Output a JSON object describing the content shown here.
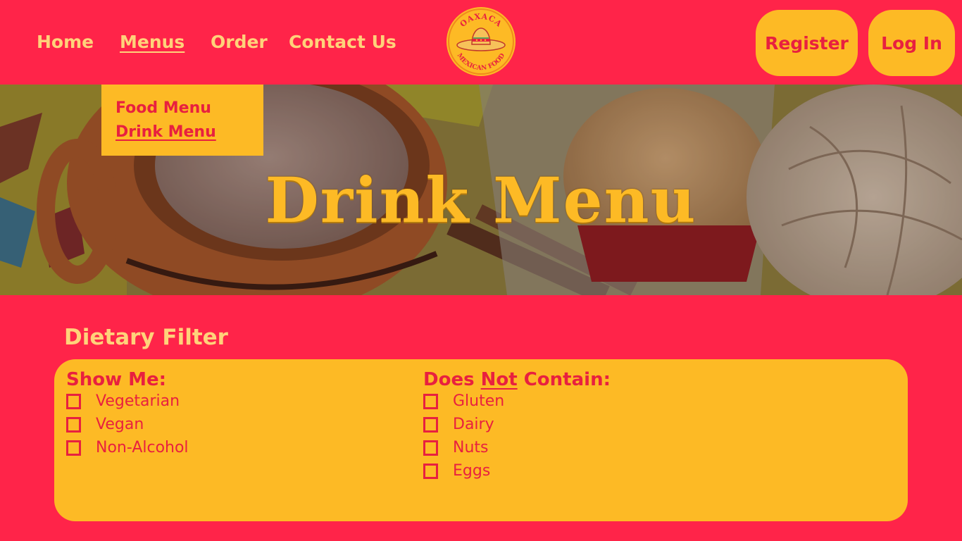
{
  "nav": {
    "links": [
      {
        "label": "Home"
      },
      {
        "label": "Menus"
      },
      {
        "label": "Order"
      },
      {
        "label": "Contact Us"
      }
    ],
    "logo": {
      "top_text": "OAXACA",
      "bottom_text": "MEXICAN FOOD"
    },
    "register_label": "Register",
    "login_label": "Log In"
  },
  "dropdown": {
    "items": [
      {
        "label": "Food Menu"
      },
      {
        "label": "Drink Menu"
      }
    ]
  },
  "hero": {
    "title": "Drink Menu"
  },
  "filter": {
    "heading": "Dietary Filter",
    "show": {
      "title": "Show Me:",
      "options": [
        {
          "label": "Vegetarian",
          "checked": false
        },
        {
          "label": "Vegan",
          "checked": false
        },
        {
          "label": "Non-Alcohol",
          "checked": false
        }
      ]
    },
    "exclude": {
      "title_before": "Does ",
      "title_emph": "Not",
      "title_after": " Contain:",
      "options": [
        {
          "label": "Gluten",
          "checked": false
        },
        {
          "label": "Dairy",
          "checked": false
        },
        {
          "label": "Nuts",
          "checked": false
        },
        {
          "label": "Eggs",
          "checked": false
        }
      ]
    }
  },
  "colors": {
    "background": "#FF2449",
    "accent": "#FDBA25",
    "text_light": "#FFD27A",
    "text_red": "#E8203F"
  }
}
